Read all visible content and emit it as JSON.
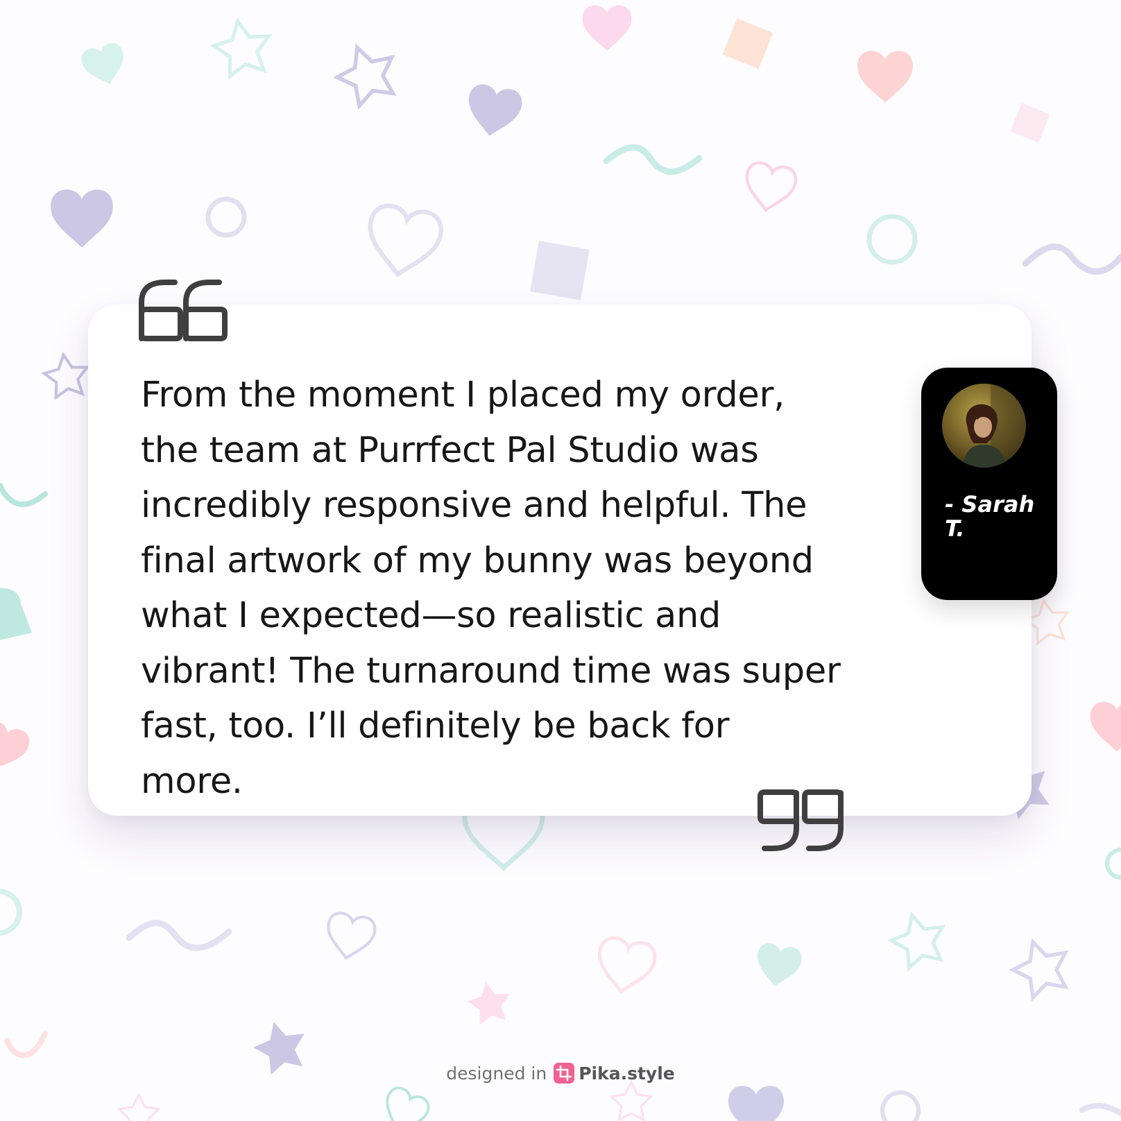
{
  "testimonial": {
    "text": "From the moment I placed my order, the team at Purrfect Pal Studio was incredibly responsive and helpful. The final artwork of my bunny was beyond what I expected—so realistic and vibrant! The turnaround time was super fast, too. I’ll definitely be back for more.",
    "author": "- Sarah T."
  },
  "watermark": {
    "prefix": "designed in",
    "brand": "Pika.style"
  },
  "colors": {
    "background": "#fdfcff",
    "card": "#ffffff",
    "text": "#171717",
    "quote_mark": "#3f3f3f",
    "author_card": "#000000",
    "brand_icon": "#f06292"
  },
  "icons": {
    "open_quote": "open-quote-icon",
    "close_quote": "close-quote-icon",
    "brand": "crop-icon"
  }
}
